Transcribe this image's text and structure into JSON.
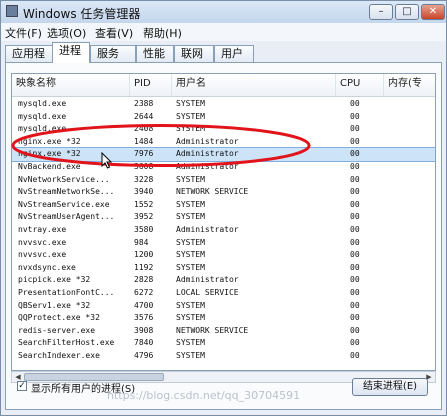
{
  "window": {
    "title": "Windows 任务管理器",
    "minimize": "–",
    "maximize": "□",
    "close": "✕"
  },
  "menu": [
    "文件(F)",
    "选项(O)",
    "查看(V)",
    "帮助(H)"
  ],
  "tabs": [
    "应用程序",
    "进程",
    "服务",
    "性能",
    "联网",
    "用户"
  ],
  "active_tab": "进程",
  "columns": [
    "映象名称",
    "PID",
    "用户名",
    "CPU",
    "内存(专"
  ],
  "processes": [
    {
      "name": "mysqld.exe",
      "pid": "2388",
      "user": "SYSTEM",
      "cpu": "00"
    },
    {
      "name": "mysqld.exe",
      "pid": "2644",
      "user": "SYSTEM",
      "cpu": "00"
    },
    {
      "name": "mysqld.exe",
      "pid": "2408",
      "user": "SYSTEM",
      "cpu": "00"
    },
    {
      "name": "nginx.exe *32",
      "pid": "1484",
      "user": "Administrator",
      "cpu": "00"
    },
    {
      "name": "nginx.exe *32",
      "pid": "7976",
      "user": "Administrator",
      "cpu": "00"
    },
    {
      "name": "NvBackend.exe",
      "pid": "3608",
      "user": "Administrator",
      "cpu": "00"
    },
    {
      "name": "NvNetworkService...",
      "pid": "3228",
      "user": "SYSTEM",
      "cpu": "00"
    },
    {
      "name": "NvStreamNetworkSe...",
      "pid": "3940",
      "user": "NETWORK SERVICE",
      "cpu": "00"
    },
    {
      "name": "NvStreamService.exe",
      "pid": "1552",
      "user": "SYSTEM",
      "cpu": "00"
    },
    {
      "name": "NvStreamUserAgent...",
      "pid": "3952",
      "user": "SYSTEM",
      "cpu": "00"
    },
    {
      "name": "nvtray.exe",
      "pid": "3580",
      "user": "Administrator",
      "cpu": "00"
    },
    {
      "name": "nvvsvc.exe",
      "pid": "984",
      "user": "SYSTEM",
      "cpu": "00"
    },
    {
      "name": "nvvsvc.exe",
      "pid": "1200",
      "user": "SYSTEM",
      "cpu": "00"
    },
    {
      "name": "nvxdsync.exe",
      "pid": "1192",
      "user": "SYSTEM",
      "cpu": "00"
    },
    {
      "name": "picpick.exe *32",
      "pid": "2828",
      "user": "Administrator",
      "cpu": "00"
    },
    {
      "name": "PresentationFontC...",
      "pid": "6272",
      "user": "LOCAL SERVICE",
      "cpu": "00"
    },
    {
      "name": "QBServ1.exe *32",
      "pid": "4700",
      "user": "SYSTEM",
      "cpu": "00"
    },
    {
      "name": "QQProtect.exe *32",
      "pid": "3576",
      "user": "SYSTEM",
      "cpu": "00"
    },
    {
      "name": "redis-server.exe",
      "pid": "3908",
      "user": "NETWORK SERVICE",
      "cpu": "00"
    },
    {
      "name": "SearchFilterHost.exe",
      "pid": "7840",
      "user": "SYSTEM",
      "cpu": "00"
    },
    {
      "name": "SearchIndexer.exe",
      "pid": "4796",
      "user": "SYSTEM",
      "cpu": "00"
    }
  ],
  "selected_row": 4,
  "show_all_checkbox": {
    "label": "显示所有用户的进程(S)",
    "checked": true,
    "mark": "✓"
  },
  "end_process_button": "结束进程(E)",
  "watermark": "https://blog.csdn.net/qq_30704591",
  "colors": {
    "selection": "#cde3f7",
    "annotation_circle": "#e0141a"
  }
}
